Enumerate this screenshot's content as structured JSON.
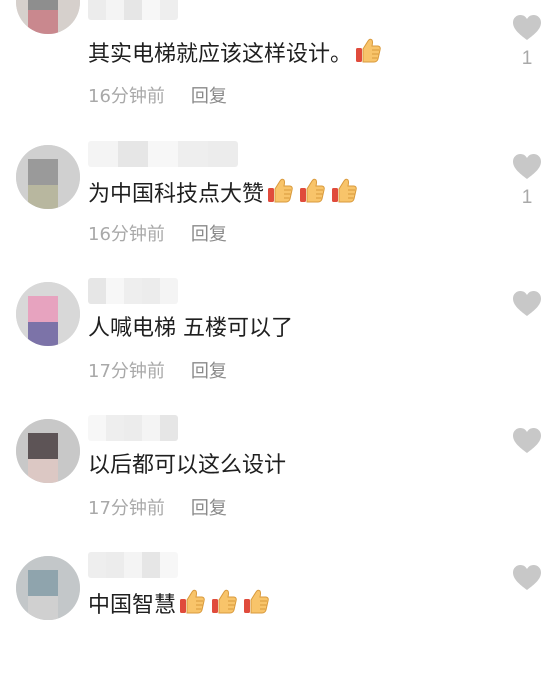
{
  "comments": [
    {
      "text": "其实电梯就应该这样设计。",
      "thumbs": 1,
      "time": "16分钟前",
      "reply": "回复",
      "likes": "1",
      "avatar_colors": [
        "#8e8e8e",
        "#c9888e",
        "#d6d0cc"
      ]
    },
    {
      "text": "为中国科技点大赞",
      "thumbs": 3,
      "time": "16分钟前",
      "reply": "回复",
      "likes": "1",
      "avatar_colors": [
        "#9a9a9a",
        "#b8b79f",
        "#d0d0d0"
      ]
    },
    {
      "text": "人喊电梯 五楼可以了",
      "thumbs": 0,
      "time": "17分钟前",
      "reply": "回复",
      "likes": "",
      "avatar_colors": [
        "#e7a3bf",
        "#7c73a8",
        "#d8d8d8"
      ]
    },
    {
      "text": "以后都可以这么设计",
      "thumbs": 0,
      "time": "17分钟前",
      "reply": "回复",
      "likes": "",
      "avatar_colors": [
        "#5d5456",
        "#dcc8c4",
        "#c8c8c8"
      ]
    },
    {
      "text": "中国智慧",
      "thumbs": 3,
      "time": "",
      "reply": "",
      "likes": "",
      "avatar_colors": [
        "#8fa4ad",
        "#d0d0d0",
        "#c3c7c9"
      ]
    }
  ],
  "icons": {
    "like": "heart-icon",
    "emoji": "thumbs-up-icon"
  },
  "colors": {
    "text": "#1f1f1f",
    "meta": "#a9a9a9",
    "heart": "#c8c8c8",
    "thumb_skin": "#f8c46a"
  }
}
